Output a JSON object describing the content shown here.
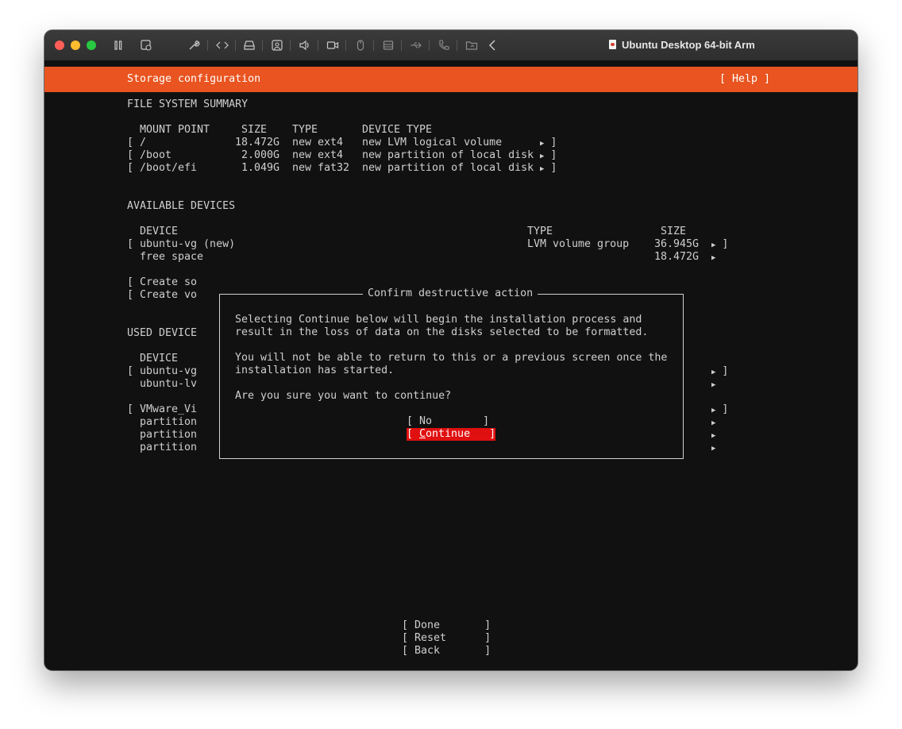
{
  "window": {
    "title": "Ubuntu Desktop 64-bit Arm",
    "toolbar_icons": [
      "pause-icon",
      "snapshot-icon",
      "wrench-icon",
      "code-arrows-icon",
      "hard-disk-icon",
      "camera-user-icon",
      "speaker-icon",
      "video-camera-icon",
      "mouse-icon",
      "printer-icon",
      "usb-icon",
      "phone-icon",
      "folder-share-icon",
      "chevron-left-icon"
    ]
  },
  "header": {
    "title": "Storage configuration",
    "help": "[ Help ]"
  },
  "fs_summary": {
    "title": "FILE SYSTEM SUMMARY",
    "columns": [
      "MOUNT POINT",
      "SIZE",
      "TYPE",
      "DEVICE TYPE"
    ],
    "rows": [
      {
        "mount": "/",
        "size": "18.472G",
        "type": "new ext4",
        "device_type": "new LVM logical volume"
      },
      {
        "mount": "/boot",
        "size": "2.000G",
        "type": "new ext4",
        "device_type": "new partition of local disk"
      },
      {
        "mount": "/boot/efi",
        "size": "1.049G",
        "type": "new fat32",
        "device_type": "new partition of local disk"
      }
    ]
  },
  "available": {
    "title": "AVAILABLE DEVICES",
    "columns": [
      "DEVICE",
      "TYPE",
      "SIZE"
    ],
    "rows": [
      {
        "device": "ubuntu-vg (new)",
        "type": "LVM volume group",
        "size": "36.945G"
      },
      {
        "device": "free space",
        "type": "",
        "size": "18.472G"
      }
    ],
    "actions": [
      "Create so",
      "Create vo"
    ]
  },
  "used": {
    "title": "USED DEVICE",
    "column": "DEVICE",
    "rows": [
      "ubuntu-vg",
      "ubuntu-lv",
      "VMware_Vi",
      "partition",
      "partition",
      "partition"
    ]
  },
  "dialog": {
    "title": "Confirm destructive action",
    "para1_line1": "Selecting Continue below will begin the installation process and",
    "para1_line2": "result in the loss of data on the disks selected to be formatted.",
    "para2_line1": "You will not be able to return to this or a previous screen once the",
    "para2_line2": "installation has started.",
    "question": "Are you sure you want to continue?",
    "no_label": "No",
    "continue_first": "C",
    "continue_rest": "ontinue"
  },
  "footer": {
    "done": "Done",
    "reset": "Reset",
    "back": "Back"
  },
  "colors": {
    "header_bg": "#e95420",
    "selected_button_bg": "#e01010",
    "screen_bg": "#111111"
  }
}
